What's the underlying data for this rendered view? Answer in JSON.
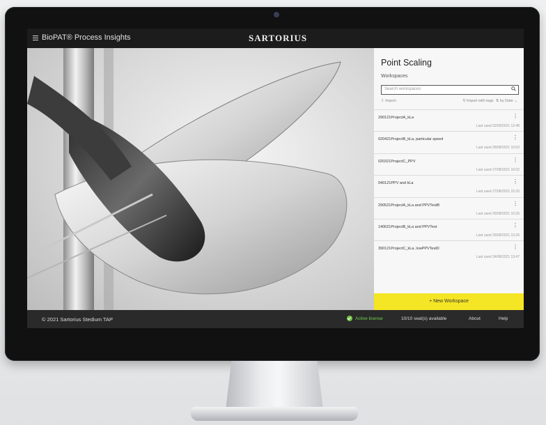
{
  "header": {
    "app_title": "BioPAT® Process Insights",
    "brand": "SARTORIUS"
  },
  "panel": {
    "title": "Point Scaling",
    "subtitle": "Workspaces",
    "search_placeholder": "Search workspaces",
    "import_label": "Import",
    "import_tags_label": "Import with tags",
    "sort_label": "by Date",
    "workspaces": [
      {
        "name": "290121ProjectA_kLa",
        "date": "Last used 02/09/2021 12:48"
      },
      {
        "name": "020421ProjectB_kLa, particular speed",
        "date": "Last used 28/08/2021 10:03"
      },
      {
        "name": "020321ProjectC_PPV",
        "date": "Last used 27/08/2021 16:02"
      },
      {
        "name": "040121PPV and kLa",
        "date": "Last used 27/08/2021 15:33"
      },
      {
        "name": "290521ProjectA_kLa and PPVTestB",
        "date": "Last used 26/08/2021 16:26"
      },
      {
        "name": "140621ProjectB_kLa and PPVTest",
        "date": "Last used 25/08/2021 13:26"
      },
      {
        "name": "390121ProjectC_kLa, lowPPVTestD",
        "date": "Last used 24/08/2021 13:47"
      }
    ],
    "new_workspace_label": "+ New Workspace"
  },
  "footer": {
    "copyright": "© 2021 Sartorius Stedium TAP",
    "license": "Active license",
    "seats": "10/10 seat(s) available",
    "about": "About",
    "help": "Help"
  },
  "colors": {
    "accent_yellow": "#f5e625",
    "license_green": "#6fc142",
    "dark_bar": "#1c1c1c"
  }
}
